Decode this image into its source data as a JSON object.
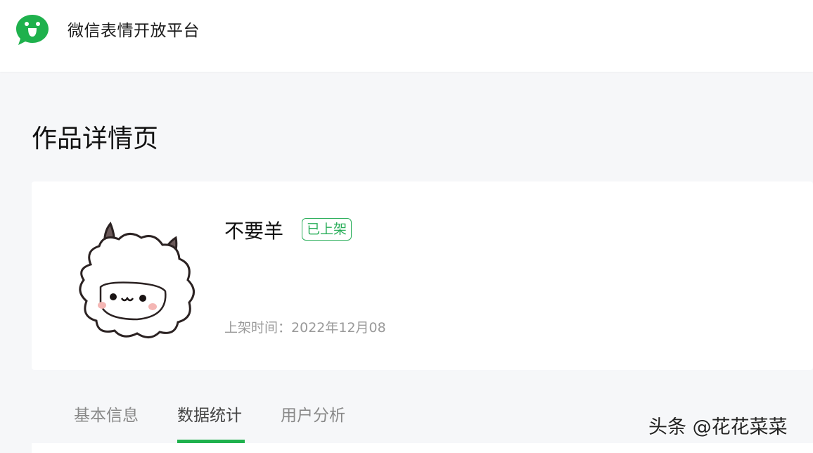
{
  "header": {
    "brand_name": "微信表情开放平台",
    "logo_icon": "wechat-sticker-logo-icon",
    "brand_color": "#1fb14d"
  },
  "page": {
    "title": "作品详情页"
  },
  "work": {
    "name": "不要羊",
    "status": "已上架",
    "status_color": "#2aae5a",
    "publish_label": "上架时间：",
    "publish_date": "2022年12月08",
    "thumbnail_icon": "sheep-sticker-icon"
  },
  "tabs": [
    {
      "label": "基本信息",
      "active": false
    },
    {
      "label": "数据统计",
      "active": true
    },
    {
      "label": "用户分析",
      "active": false
    }
  ],
  "watermark": "头条 @花花菜菜"
}
